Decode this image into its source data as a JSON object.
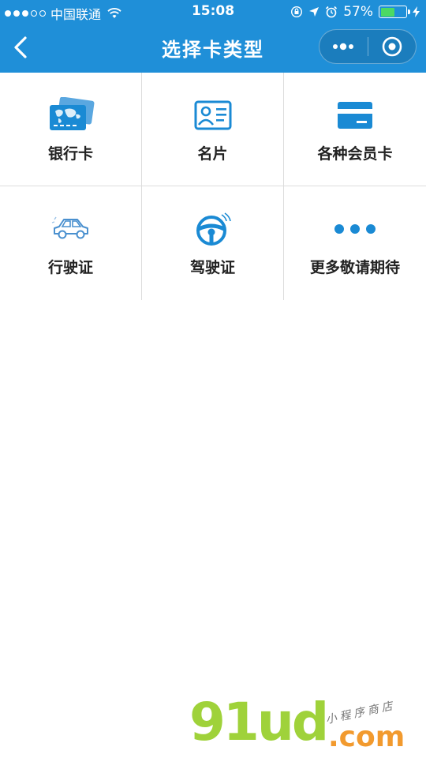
{
  "status_bar": {
    "carrier": "中国联通",
    "time": "15:08",
    "battery_percent": "57%",
    "battery_level": 0.57,
    "signal_bars_filled": 3,
    "signal_bars_total": 5
  },
  "nav": {
    "title": "选择卡类型",
    "back_icon": "chevron-left-icon",
    "more_icon": "more-dots-icon",
    "close_icon": "target-circle-icon"
  },
  "card_types": [
    {
      "label": "银行卡",
      "icon": "bank-card-icon"
    },
    {
      "label": "名片",
      "icon": "business-card-icon"
    },
    {
      "label": "各种会员卡",
      "icon": "membership-card-icon"
    },
    {
      "label": "行驶证",
      "icon": "car-icon"
    },
    {
      "label": "驾驶证",
      "icon": "steering-wheel-icon"
    },
    {
      "label": "更多敬请期待",
      "icon": "ellipsis-icon"
    }
  ],
  "watermark": {
    "brand": "91ud",
    "domain": ".com",
    "tagline": "小程序商店"
  },
  "colors": {
    "primary": "#1f8fd8",
    "icon_blue": "#1a8ad4",
    "battery_green": "#4cd964",
    "watermark_green": "#9fd23a",
    "watermark_orange": "#f29a2e"
  }
}
